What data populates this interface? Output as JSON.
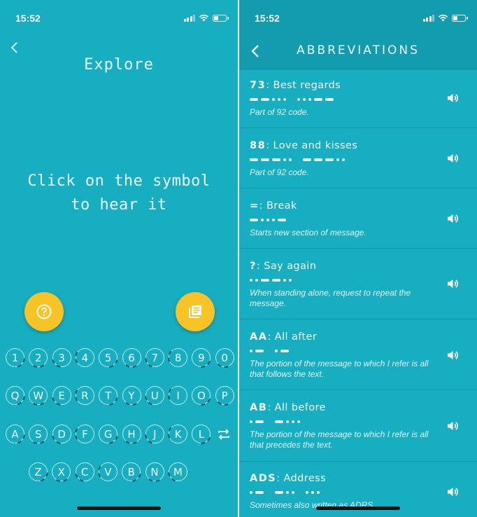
{
  "left": {
    "status": {
      "time": "15:52"
    },
    "title": "Explore",
    "hint_line1": "Click on the symbol",
    "hint_line2": "to hear it",
    "icons": {
      "back": "chevron-left-icon",
      "help": "help-circle-icon",
      "list": "library-books-icon",
      "repeat": "repeat-icon"
    },
    "keys": {
      "row1": [
        "1",
        "2",
        "3",
        "4",
        "5",
        "6",
        "7",
        "8",
        "9",
        "0"
      ],
      "row2": [
        "Q",
        "W",
        "E",
        "R",
        "T",
        "Y",
        "U",
        "I",
        "O",
        "P"
      ],
      "row3": [
        "A",
        "S",
        "D",
        "F",
        "G",
        "H",
        "J",
        "K",
        "L"
      ],
      "row4": [
        "Z",
        "X",
        "C",
        "V",
        "B",
        "N",
        "M"
      ]
    }
  },
  "right": {
    "status": {
      "time": "15:52"
    },
    "title": "ABBREVIATIONS",
    "items": [
      {
        "abbr": "73",
        "meaning": ": Best regards",
        "desc": "Part of 92 code.",
        "code": "--... ...--"
      },
      {
        "abbr": "88",
        "meaning": ": Love and kisses",
        "desc": "Part of 92 code.",
        "code": "---.. ---.."
      },
      {
        "abbr": "=",
        "meaning": ": Break",
        "desc": "Starts new section of message.",
        "code": "-...-"
      },
      {
        "abbr": "?",
        "meaning": ": Say again",
        "desc": "When standing alone, request to repeat the message.",
        "code": "..--.."
      },
      {
        "abbr": "AA",
        "meaning": ": All after",
        "desc": "The portion of the message to which I refer is all that follows the text.",
        "code": ".- .-"
      },
      {
        "abbr": "AB",
        "meaning": ": All before",
        "desc": "The portion of the message to which I refer is all that precedes the text.",
        "code": ".- -..."
      },
      {
        "abbr": "ADS",
        "meaning": ": Address",
        "desc": "Sometimes also written as ADRS",
        "code": ".- -.. ..."
      }
    ]
  },
  "colors": {
    "background": "#17aec2",
    "header": "#139bae",
    "accent": "#f7c325",
    "text": "#eafcff"
  }
}
